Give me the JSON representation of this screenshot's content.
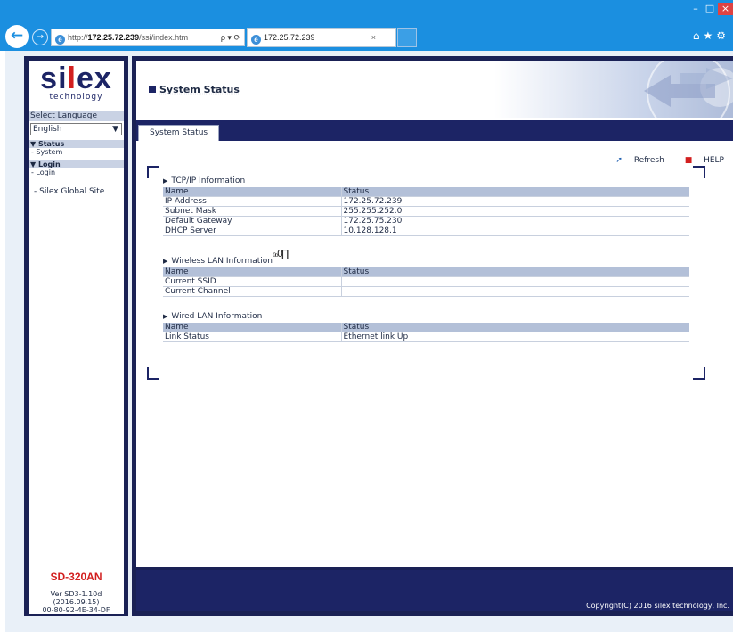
{
  "browser": {
    "url_prefix": "http://",
    "url_host": "172.25.72.239",
    "url_path": "/ssi/index.htm",
    "url_actions": "ρ ▾ ⟳",
    "tab_title": "172.25.72.239",
    "tab_close": "×",
    "tools": "⌂★⚙",
    "min": "–",
    "max": "□",
    "close": "×"
  },
  "sidebar": {
    "logo_main": "si",
    "logo_accent": "l",
    "logo_tail": "ex",
    "logo_sub": "technology",
    "select_language_label": "Select Language",
    "language": "English",
    "status_header": "▼ Status",
    "status_item": "- System",
    "login_header": "▼ Login",
    "login_item": "- Login",
    "global_link": "- Silex Global Site",
    "model": "SD-320AN",
    "version_line1": "Ver SD3-1.10d",
    "version_line2": "(2016.09.15)",
    "mac": "00-80-92-4E-34-DF"
  },
  "main": {
    "page_title": "System Status",
    "tab_label": "System Status",
    "refresh": "Refresh",
    "help": "HELP",
    "copyright": "Copyright(C) 2016 silex technology, Inc."
  },
  "tcpip": {
    "title": "TCP/IP Information",
    "col_name": "Name",
    "col_status": "Status",
    "rows": [
      {
        "name": "IP Address",
        "value": "172.25.72.239"
      },
      {
        "name": "Subnet Mask",
        "value": "255.255.252.0"
      },
      {
        "name": "Default Gateway",
        "value": "172.25.75.230"
      },
      {
        "name": "DHCP Server",
        "value": "10.128.128.1"
      }
    ]
  },
  "wireless": {
    "title": "Wireless LAN Information",
    "signal": "₀ₒ0∏",
    "col_name": "Name",
    "col_status": "Status",
    "rows": [
      {
        "name": "Current SSID",
        "value": ""
      },
      {
        "name": "Current Channel",
        "value": ""
      }
    ]
  },
  "wired": {
    "title": "Wired LAN Information",
    "col_name": "Name",
    "col_status": "Status",
    "rows": [
      {
        "name": "Link Status",
        "value": "Ethernet link Up"
      }
    ]
  },
  "colors": {
    "navy": "#1c2465",
    "accent_red": "#d21f1f",
    "browser_blue": "#1b8fe0"
  }
}
